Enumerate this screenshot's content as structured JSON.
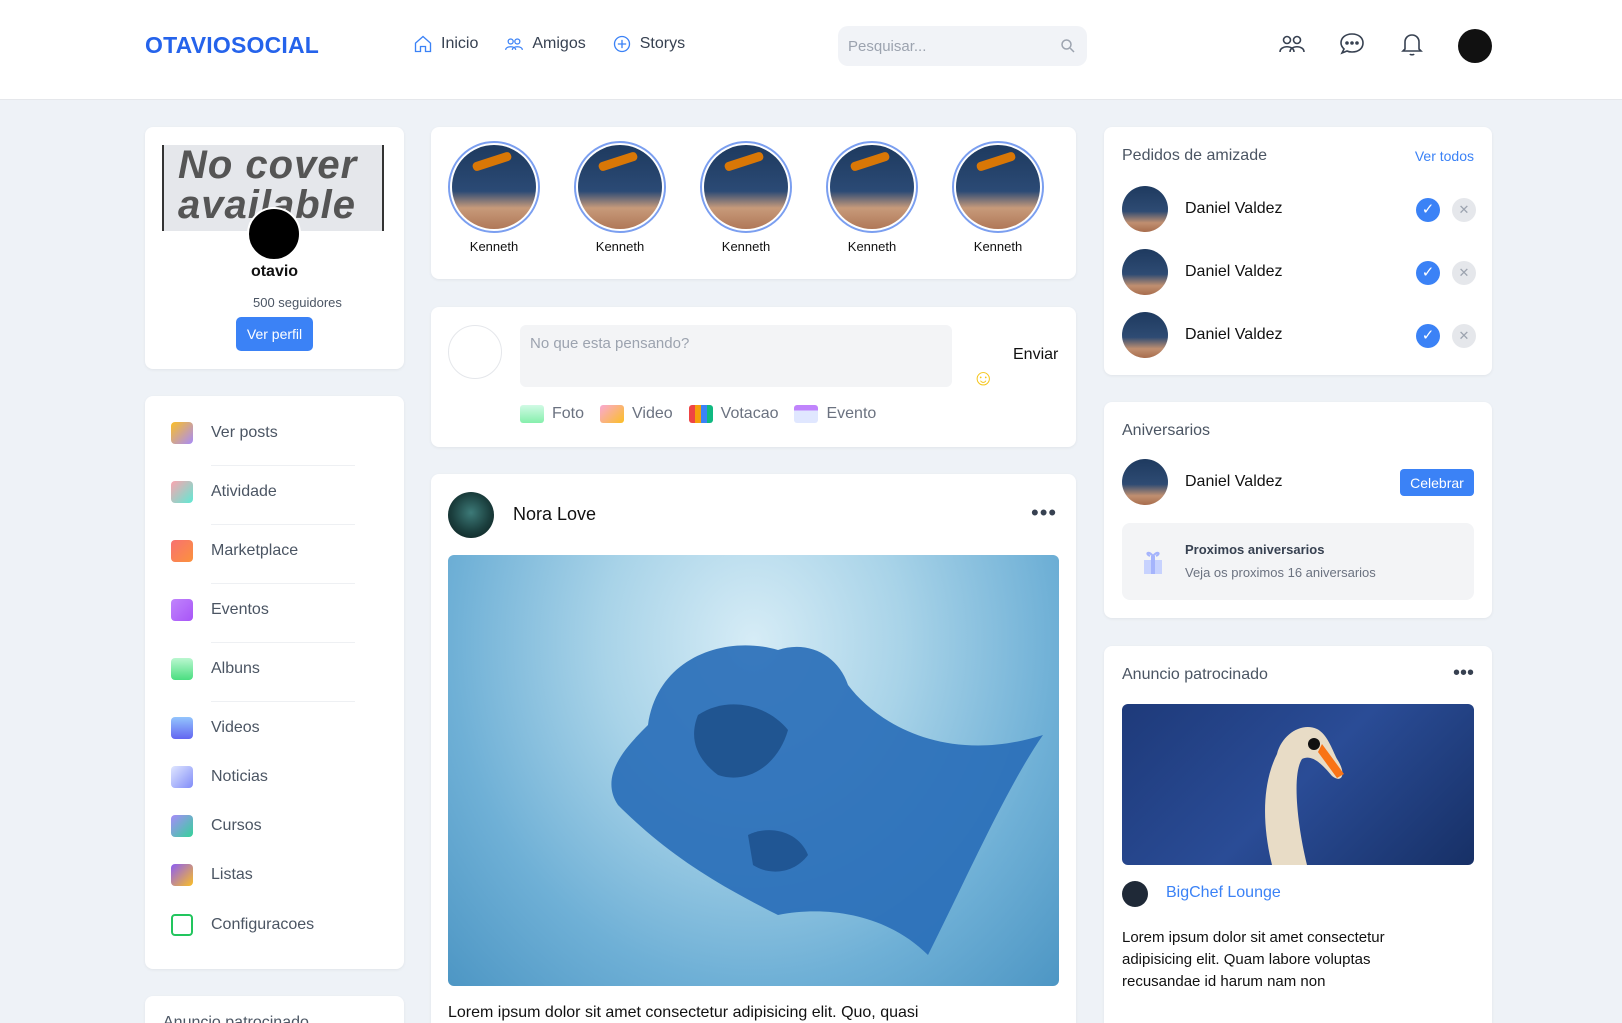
{
  "header": {
    "brand": "OTAVIOSOCIAL",
    "nav": [
      {
        "label": "Inicio",
        "icon": "home-icon"
      },
      {
        "label": "Amigos",
        "icon": "friends-icon"
      },
      {
        "label": "Storys",
        "icon": "plus-circle-icon"
      }
    ],
    "search_placeholder": "Pesquisar...",
    "icons": [
      "people-icon",
      "chat-icon",
      "bell-icon"
    ]
  },
  "profile": {
    "cover_text": "No cover available",
    "name": "otavio",
    "followers": "500 seguidores",
    "button": "Ver perfil"
  },
  "menu": [
    {
      "label": "Ver posts"
    },
    {
      "label": "Atividade"
    },
    {
      "label": "Marketplace"
    },
    {
      "label": "Eventos"
    },
    {
      "label": "Albuns"
    },
    {
      "label": "Videos"
    },
    {
      "label": "Noticias"
    },
    {
      "label": "Cursos"
    },
    {
      "label": "Listas"
    },
    {
      "label": "Configuracoes"
    }
  ],
  "left_ad_title": "Anuncio patrocinado",
  "stories": [
    {
      "name": "Kenneth"
    },
    {
      "name": "Kenneth"
    },
    {
      "name": "Kenneth"
    },
    {
      "name": "Kenneth"
    },
    {
      "name": "Kenneth"
    }
  ],
  "composer": {
    "placeholder": "No que esta pensando?",
    "send": "Enviar",
    "actions": [
      {
        "label": "Foto",
        "color": "#a7e3c4"
      },
      {
        "label": "Video",
        "color": "#f3a7d6"
      },
      {
        "label": "Votacao",
        "color": "#f87171"
      },
      {
        "label": "Evento",
        "color": "#a5b4fc"
      }
    ]
  },
  "post": {
    "author": "Nora Love",
    "more": "•••",
    "text": "Lorem ipsum dolor sit amet consectetur adipisicing elit. Quo, quasi"
  },
  "friend_requests": {
    "title": "Pedidos de amizade",
    "link": "Ver todos",
    "items": [
      {
        "name": "Daniel Valdez"
      },
      {
        "name": "Daniel Valdez"
      },
      {
        "name": "Daniel Valdez"
      }
    ]
  },
  "birthdays": {
    "title": "Aniversarios",
    "name": "Daniel Valdez",
    "button": "Celebrar",
    "upcoming_title": "Proximos aniversarios",
    "upcoming_sub": "Veja os proximos 16 aniversarios"
  },
  "sponsored": {
    "title": "Anuncio patrocinado",
    "more": "•••",
    "brand": "BigChef Lounge",
    "text": "Lorem ipsum dolor sit amet consectetur adipisicing elit. Quam labore voluptas recusandae id harum nam non"
  }
}
